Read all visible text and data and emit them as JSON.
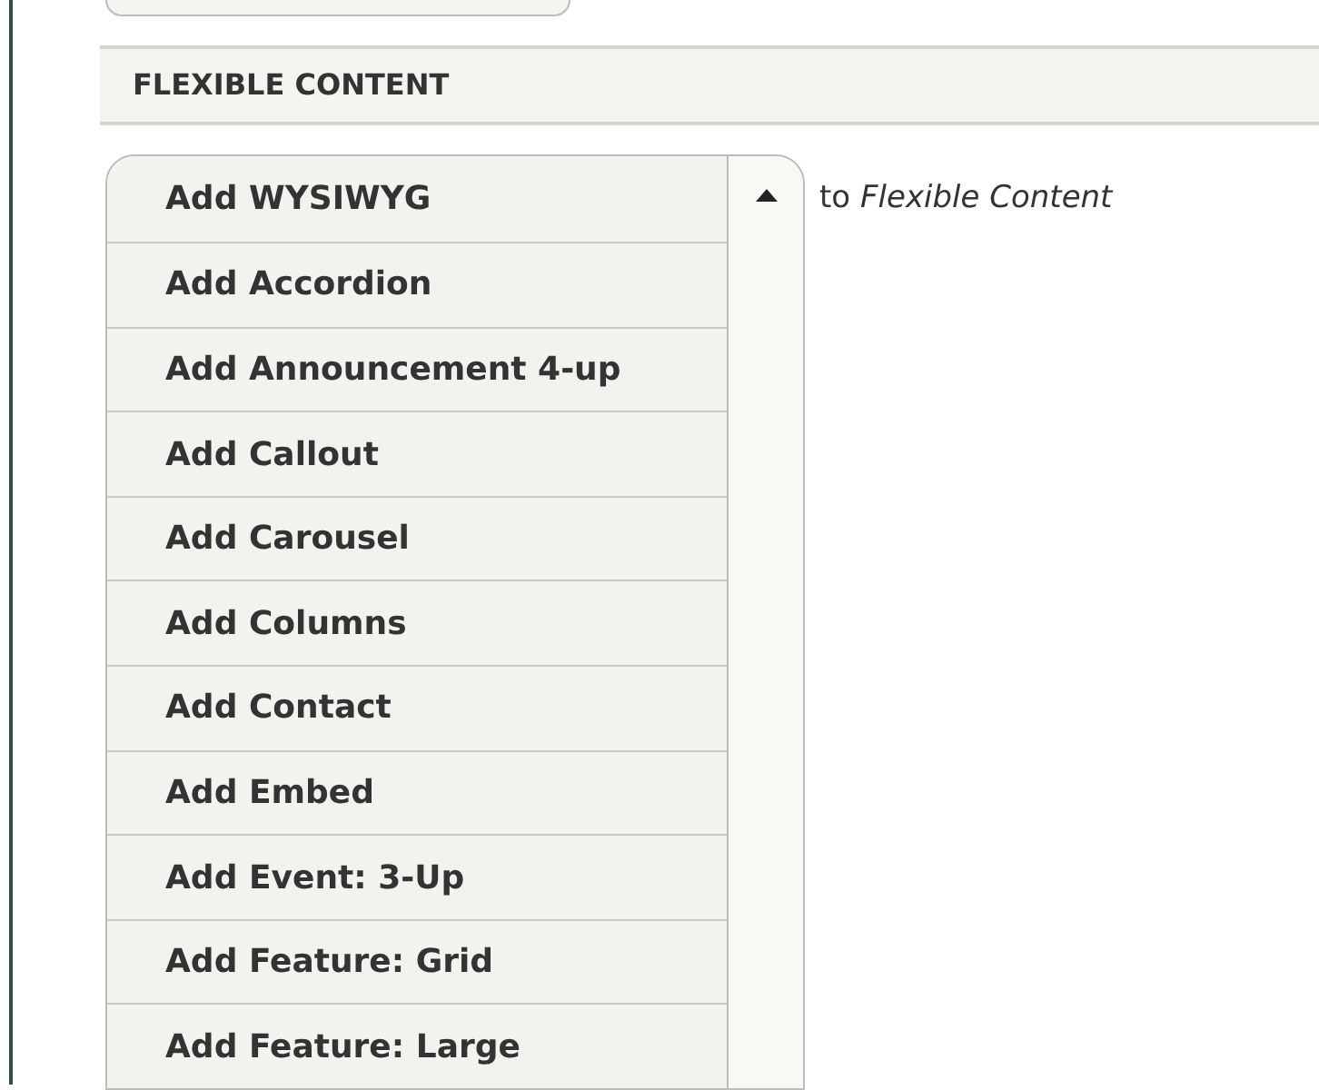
{
  "section": {
    "title": "FLEXIBLE CONTENT"
  },
  "add_menu": {
    "items": [
      {
        "label": "Add WYSIWYG"
      },
      {
        "label": "Add Accordion"
      },
      {
        "label": "Add Announcement 4-up"
      },
      {
        "label": "Add Callout"
      },
      {
        "label": "Add Carousel"
      },
      {
        "label": "Add Columns"
      },
      {
        "label": "Add Contact"
      },
      {
        "label": "Add Embed"
      },
      {
        "label": "Add Event: 3-Up"
      },
      {
        "label": "Add Feature: Grid"
      },
      {
        "label": "Add Feature: Large"
      }
    ],
    "suffix": "to *Flexible Content*"
  }
}
